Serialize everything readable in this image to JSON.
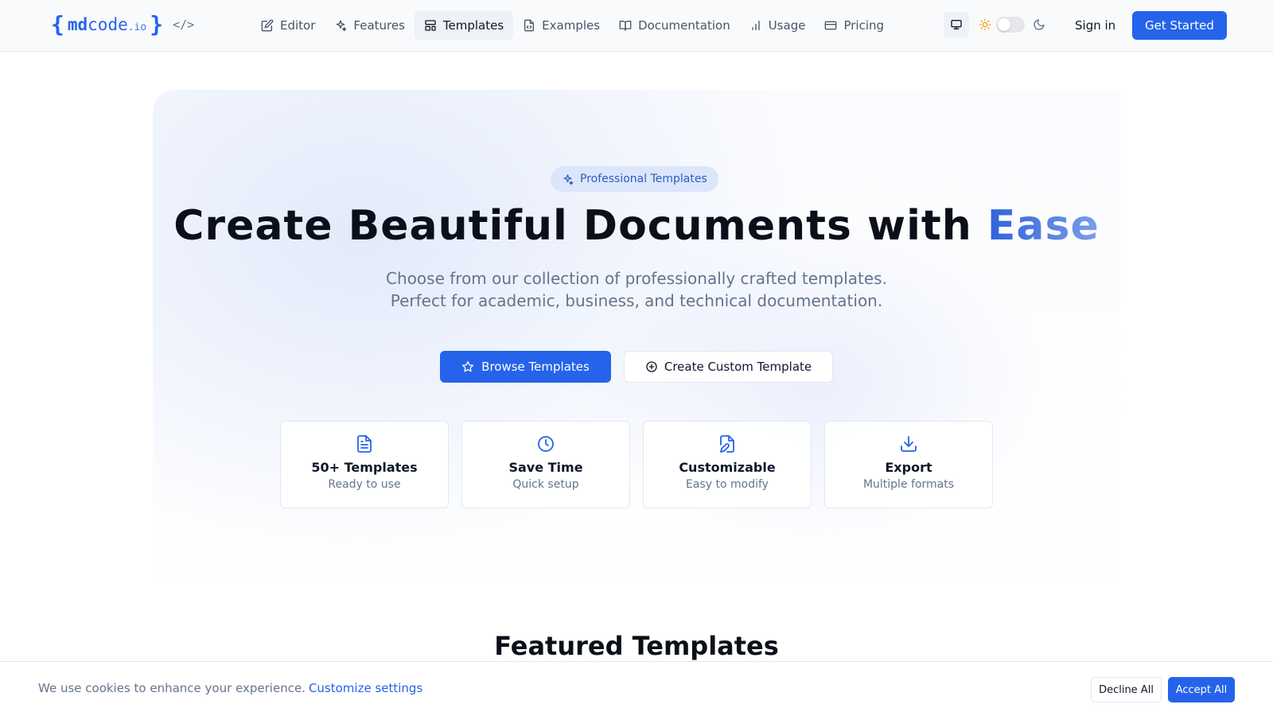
{
  "header": {
    "logo": {
      "open_brace": "{",
      "md": "md",
      "code": "code",
      "tld": ".io",
      "close_brace": "}",
      "tag": "</>"
    },
    "nav": [
      {
        "label": "Editor",
        "icon": "pencil-square-icon",
        "active": false
      },
      {
        "label": "Features",
        "icon": "sparkles-icon",
        "active": false
      },
      {
        "label": "Templates",
        "icon": "layout-icon",
        "active": true
      },
      {
        "label": "Examples",
        "icon": "file-code-icon",
        "active": false
      },
      {
        "label": "Documentation",
        "icon": "book-open-icon",
        "active": false
      },
      {
        "label": "Usage",
        "icon": "bar-chart-icon",
        "active": false
      },
      {
        "label": "Pricing",
        "icon": "credit-card-icon",
        "active": false
      }
    ],
    "theme": {
      "device_icon": "monitor-icon",
      "light_icon": "sun-icon",
      "dark_icon": "moon-icon",
      "dark_mode_on": false
    },
    "sign_in": "Sign in",
    "get_started": "Get Started"
  },
  "hero": {
    "badge": "Professional Templates",
    "title_main": "Create Beautiful Documents with ",
    "title_accent": "Ease",
    "subtitle_line1": "Choose from our collection of professionally crafted templates.",
    "subtitle_line2": "Perfect for academic, business, and technical documentation.",
    "primary_button": "Browse Templates",
    "secondary_button": "Create Custom Template",
    "features": [
      {
        "title": "50+ Templates",
        "subtitle": "Ready to use",
        "icon": "document-icon"
      },
      {
        "title": "Save Time",
        "subtitle": "Quick setup",
        "icon": "clock-icon"
      },
      {
        "title": "Customizable",
        "subtitle": "Easy to modify",
        "icon": "file-edit-icon"
      },
      {
        "title": "Export",
        "subtitle": "Multiple formats",
        "icon": "download-icon"
      }
    ]
  },
  "featured": {
    "title": "Featured Templates"
  },
  "cookie_banner": {
    "message": "We use cookies to enhance your experience.",
    "link": "Customize settings",
    "decline": "Decline All",
    "accept": "Accept All"
  },
  "colors": {
    "brand": "#2563eb",
    "accent_gradient_end": "#7c9ee9",
    "muted_text": "#64748b",
    "sun": "#f59e0b"
  }
}
